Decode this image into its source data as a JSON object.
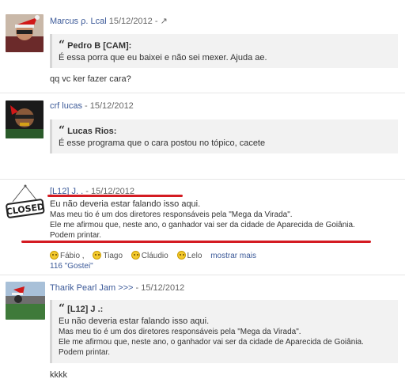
{
  "posts": [
    {
      "author": "Marcus ρ. Lcal",
      "date": "15/12/2012",
      "date_suffix": "- ↗",
      "quote": {
        "title": "Pedro B [CAM]:",
        "lines": [
          "É essa porra que eu baixei e não sei mexer. Ajuda ae."
        ]
      },
      "body": [
        "qq vc ker fazer cara?"
      ]
    },
    {
      "author": "crf lucas",
      "date": "- 15/12/2012",
      "quote": {
        "title": "Lucas Rios:",
        "lines": [
          "É esse programa que o cara postou no tópico, cacete"
        ]
      },
      "body": []
    },
    {
      "author": "[L12] J. .",
      "date": "- 15/12/2012",
      "body": [
        "Eu não deveria estar falando isso aqui.",
        "Mas meu tio é um dos diretores responsáveis pela \"Mega da Virada\".",
        "Ele me afirmou que, neste ano, o ganhador vai ser da cidade de Aparecida de Goiânia.",
        "Podem printar."
      ],
      "badge": "CLOSED",
      "reactions": [
        "Fábio",
        "Tiago",
        "Cláudio",
        "Lelo"
      ],
      "more_label": "mostrar mais",
      "likes": "116 \"Gostei\""
    },
    {
      "author": "Tharik Pearl Jam >>>",
      "date": "- 15/12/2012",
      "quote": {
        "title": "[L12] J .:",
        "lines": [
          "Eu não deveria estar falando isso aqui.",
          "Mas meu tio é um dos diretores responsáveis pela \"Mega da Virada\".",
          "Ele me afirmou que, neste ano, o ganhador vai ser da cidade de Aparecida de Goiânia.",
          "Podem printar."
        ]
      },
      "body": [
        "kkkk"
      ]
    }
  ],
  "colors": {
    "link": "#3b5998",
    "highlight": "#d41b22",
    "quote_bg": "#f2f2f2"
  }
}
